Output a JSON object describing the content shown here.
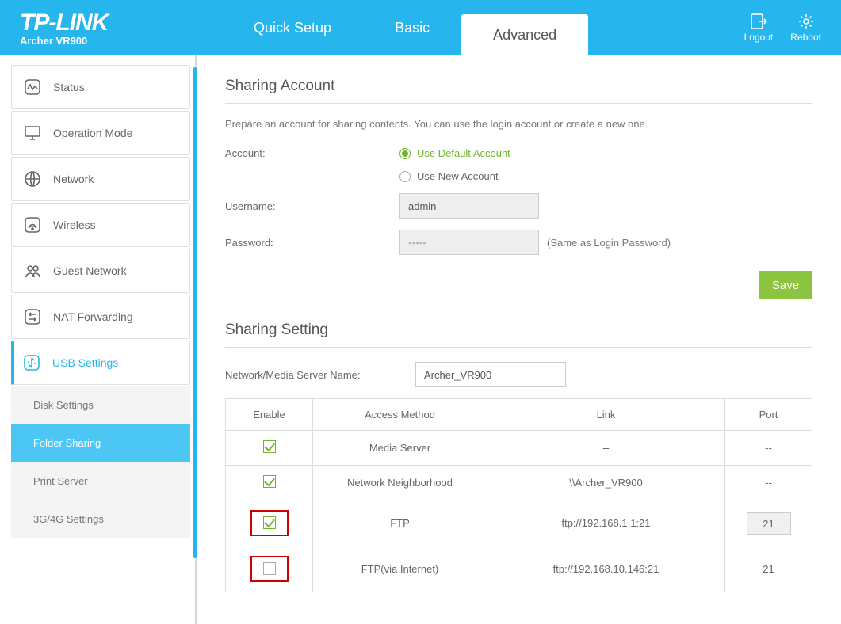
{
  "brand": {
    "logo": "TP-LINK",
    "model": "Archer VR900"
  },
  "topnav": {
    "quick": "Quick Setup",
    "basic": "Basic",
    "advanced": "Advanced"
  },
  "topright": {
    "logout": "Logout",
    "reboot": "Reboot"
  },
  "sidebar": {
    "items": [
      {
        "label": "Status"
      },
      {
        "label": "Operation Mode"
      },
      {
        "label": "Network"
      },
      {
        "label": "Wireless"
      },
      {
        "label": "Guest Network"
      },
      {
        "label": "NAT Forwarding"
      },
      {
        "label": "USB Settings"
      }
    ],
    "sub": [
      {
        "label": "Disk Settings"
      },
      {
        "label": "Folder Sharing"
      },
      {
        "label": "Print Server"
      },
      {
        "label": "3G/4G Settings"
      }
    ]
  },
  "section1": {
    "title": "Sharing Account",
    "desc": "Prepare an account for sharing contents. You can use the login account or create a new one.",
    "account_lbl": "Account:",
    "opt_default": "Use Default Account",
    "opt_new": "Use New Account",
    "username_lbl": "Username:",
    "username_val": "admin",
    "password_lbl": "Password:",
    "password_hint": "(Same as Login Password)",
    "password_dots": "•••••",
    "save": "Save"
  },
  "section2": {
    "title": "Sharing Setting",
    "server_lbl": "Network/Media Server Name:",
    "server_val": "Archer_VR900",
    "cols": {
      "enable": "Enable",
      "method": "Access Method",
      "link": "Link",
      "port": "Port"
    },
    "rows": [
      {
        "enabled": true,
        "method": "Media Server",
        "link": "--",
        "port": "--",
        "hi": false,
        "portbox": false
      },
      {
        "enabled": true,
        "method": "Network Neighborhood",
        "link": "\\\\Archer_VR900",
        "port": "--",
        "hi": false,
        "portbox": false
      },
      {
        "enabled": true,
        "method": "FTP",
        "link": "ftp://192.168.1.1:21",
        "port": "21",
        "hi": true,
        "portbox": true
      },
      {
        "enabled": false,
        "method": "FTP(via Internet)",
        "link": "ftp://192.168.10.146:21",
        "port": "21",
        "hi": true,
        "portbox": false
      }
    ]
  }
}
